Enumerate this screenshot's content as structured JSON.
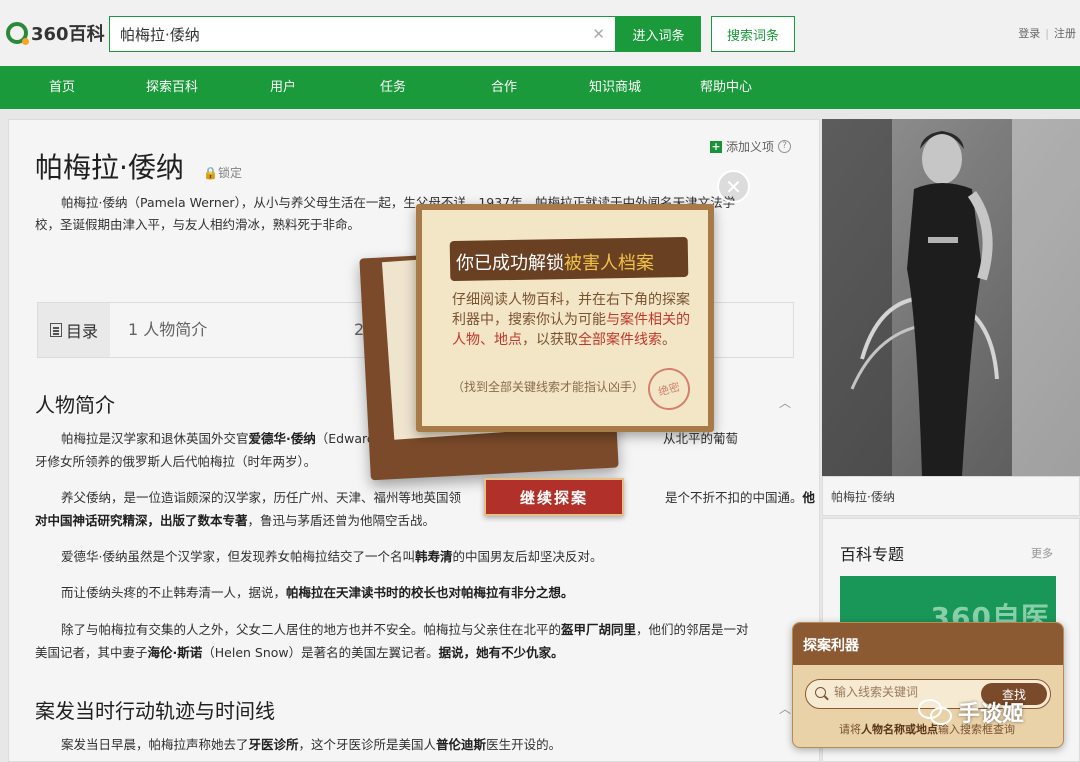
{
  "header": {
    "logo_text": "360百科",
    "search_value": "帕梅拉·倭纳",
    "enter_label": "进入词条",
    "search_label": "搜索词条",
    "login": "登录",
    "register": "注册"
  },
  "nav": [
    "首页",
    "探索百科",
    "用户",
    "任务",
    "合作",
    "知识商城",
    "帮助中心"
  ],
  "article": {
    "title": "帕梅拉·倭纳",
    "lock": "锁定",
    "add_meaning": "添加义项",
    "intro_line1": "帕梅拉·倭纳（Pamela Werner），从小与养父母生活在一起，生父母不详。1937年，帕梅拉正就读于中外闻名天津文法学",
    "intro_line2": "校，圣诞假期由津入平，与友人相约滑冰，熟料死于非命。",
    "toc_head": "目录",
    "toc_item1": "1 人物简介",
    "toc_item2": "2",
    "section1_title": "人物简介",
    "s1p1a": "帕梅拉是汉学家和退休英国外交官",
    "s1p1b": "爱德华·倭纳",
    "s1p1c": "（Edward",
    "s1p1d": "从北平的葡萄",
    "s1p1e": "牙修女所领养的俄罗斯人后代帕梅拉（时年两岁）。",
    "s1p2a": "养父倭纳，是一位造诣颇深的汉学家，历任广州、天津、福州等地英国领",
    "s1p2b": "是个不折不扣的中国通。",
    "s1p2c": "他",
    "s1p2d": "对中国神话研究精深，出版了数本专著",
    "s1p2e": "，鲁迅与茅盾还曾为他隔空舌战。",
    "s1p3a": "爱德华·倭纳虽然是个汉学家，但发现养女帕梅拉结交了一个名叫",
    "s1p3b": "韩寿清",
    "s1p3c": "的中国男友后却坚决反对。",
    "s1p4a": "而让倭纳头疼的不止韩寿清一人，据说，",
    "s1p4b": "帕梅拉在天津读书时的校长也对帕梅拉有非分之想。",
    "s1p5a": "除了与帕梅拉有交集的人之外，父女二人居住的地方也并不安全。帕梅拉与父亲住在北平的",
    "s1p5b": "盔甲厂胡同里",
    "s1p5c": "，他们的邻居是一对",
    "s1p5d": "美国记者，其中妻子",
    "s1p5e": "海伦·斯诺",
    "s1p5f": "（Helen Snow）是著名的美国左翼记者。",
    "s1p5g": "据说，她有不少仇家。",
    "section2_title": "案发当时行动轨迹与时间线",
    "s2p1a": "案发当日早晨，帕梅拉声称她去了",
    "s2p1b": "牙医诊所",
    "s2p1c": "，这个牙医诊所是美国人",
    "s2p1d": "普伦迪斯",
    "s2p1e": "医生开设的。"
  },
  "sidebar": {
    "image_caption": "帕梅拉·倭纳",
    "topic_title": "百科专题",
    "topic_more": "更多",
    "banner_text": "360自医"
  },
  "popup": {
    "heading_a": "你已成功解锁",
    "heading_b": "被害人档案",
    "text_a": "仔细阅读人物百科，并在右下角的探案利器中，搜索你认为可能",
    "text_b": "与案件相关的人物、地点",
    "text_c": "，以获取",
    "text_d": "全部案件线索",
    "text_e": "。",
    "hint": "（找到全部关键线索才能指认凶手）",
    "stamp": "绝密",
    "continue_label": "继续探案"
  },
  "detector": {
    "title": "探案利器",
    "placeholder": "输入线索关键词",
    "find_label": "查找",
    "hint_a": "请将",
    "hint_b": "人物名称或地点",
    "hint_c": "输入搜索框查询"
  },
  "watermark": "手谈姬",
  "colors": {
    "brand_green": "#1a9a3b",
    "popup_brown": "#7b4a2a",
    "button_red": "#b1302a",
    "highlight_red": "#c0392b"
  }
}
